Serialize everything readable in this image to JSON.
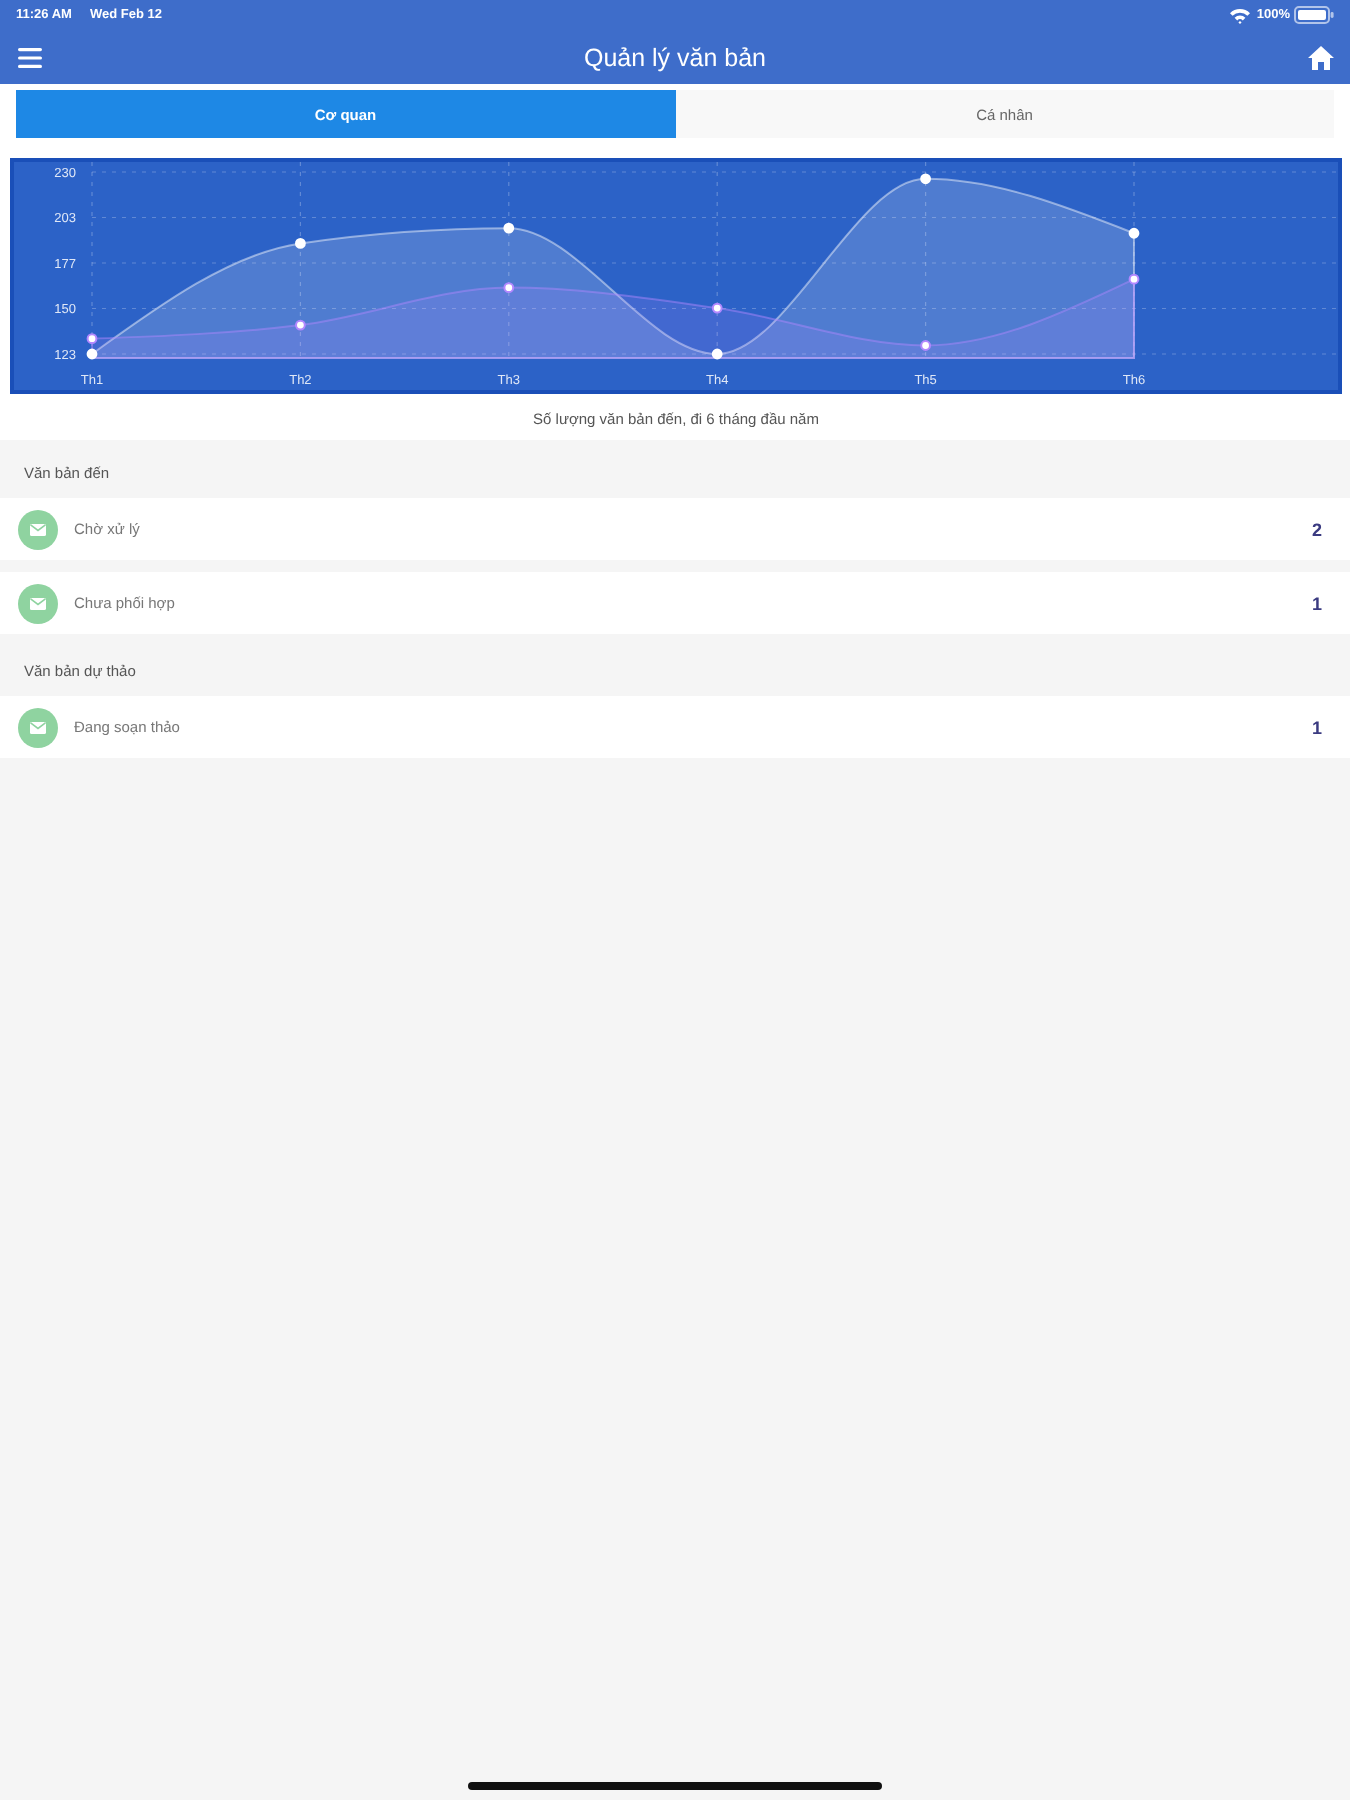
{
  "status_bar": {
    "time": "11:26 AM",
    "date": "Wed Feb 12",
    "battery": "100%"
  },
  "nav_bar": {
    "title": "Quản lý văn bản"
  },
  "tabs": [
    {
      "label": "Cơ quan",
      "selected": true
    },
    {
      "label": "Cá nhân",
      "selected": false
    }
  ],
  "chart": {
    "chart_data": {
      "type": "area",
      "title": "Số lượng văn bản đến, đi 6 tháng đầu năm",
      "categories": [
        "Th1",
        "Th2",
        "Th3",
        "Th4",
        "Th5",
        "Th6"
      ],
      "series": [
        {
          "color": "#ffffff",
          "values": [
            123,
            188,
            197,
            123,
            226,
            194
          ]
        },
        {
          "color": "#b388ff",
          "values": [
            132,
            140,
            162,
            150,
            128,
            167
          ]
        }
      ],
      "ylim": [
        123,
        230
      ],
      "yticks": [
        {
          "value": 123,
          "label": "123"
        },
        {
          "value": 149.75,
          "label": "150"
        },
        {
          "value": 176.5,
          "label": "177"
        },
        {
          "value": 203.25,
          "label": "203"
        },
        {
          "value": 230,
          "label": "230"
        }
      ],
      "grid": true
    }
  },
  "sections": [
    {
      "title": "Văn bản đến",
      "items": [
        {
          "label": "Chờ xử lý",
          "count": "2"
        },
        {
          "label": "Chưa phối hợp",
          "count": "1"
        }
      ]
    },
    {
      "title": "Văn bản dự thảo",
      "items": [
        {
          "label": "Đang soạn thảo",
          "count": "1"
        }
      ]
    }
  ]
}
